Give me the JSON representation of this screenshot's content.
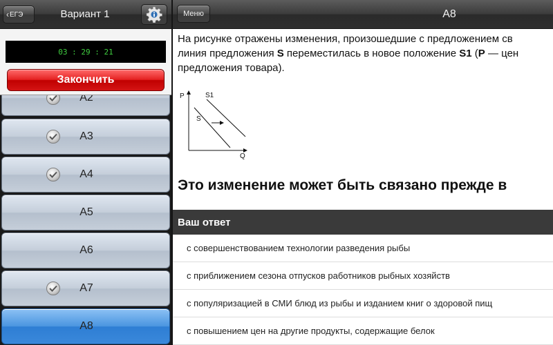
{
  "header": {
    "back_label": "ЕГЭ",
    "variant_title": "Вариант 1",
    "menu_label": "Меню",
    "question_title": "А8"
  },
  "timer": {
    "time": "03 : 29 : 21",
    "finish_label": "Закончить"
  },
  "sidebar": {
    "items": [
      {
        "label": "А2",
        "checked": true
      },
      {
        "label": "А3",
        "checked": true
      },
      {
        "label": "А4",
        "checked": true
      },
      {
        "label": "А5",
        "checked": false
      },
      {
        "label": "А6",
        "checked": false
      },
      {
        "label": "А7",
        "checked": true
      },
      {
        "label": "А8",
        "checked": false,
        "active": true
      }
    ]
  },
  "question": {
    "line1": "На рисунке отражены изменения, произошедшие с предложением св",
    "line2_prefix": "линия предложения ",
    "line2_s": "S",
    "line2_mid": " переместилась в новое положение ",
    "line2_s1": "S1",
    "line2_open": " (",
    "line2_p": "P",
    "line2_end": " — цен",
    "line3": "предложения товара).",
    "diagram_labels": {
      "p": "P",
      "q": "Q",
      "s": "S",
      "s1": "S1"
    },
    "prompt": "Это изменение может быть связано прежде в"
  },
  "answers": {
    "header": "Ваш ответ",
    "options": [
      "с совершенствованием технологии разведения рыбы",
      "с приближением сезона отпусков работников рыбных хозяйств",
      "с популяризацией в СМИ блюд из рыбы и изданием книг о здоровой пищ",
      "с повышением цен на другие продукты, содержащие белок"
    ]
  },
  "colors": {
    "finish_button": "#d41414",
    "active_item": "#3a88da",
    "timer_text": "#40d040",
    "answer_header": "#3a3a3a"
  }
}
